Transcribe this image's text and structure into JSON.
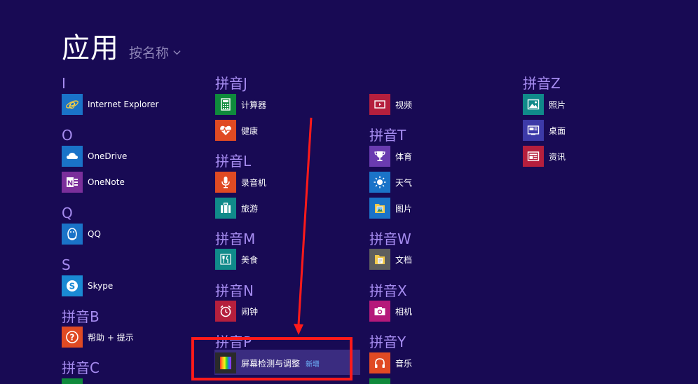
{
  "header": {
    "title": "应用",
    "sort_label": "按名称"
  },
  "groups": {
    "I": "I",
    "O": "O",
    "Q": "Q",
    "S": "S",
    "B": "拼音B",
    "C": "拼音C",
    "J": "拼音J",
    "L": "拼音L",
    "M": "拼音M",
    "N": "拼音N",
    "P": "拼音P",
    "T": "拼音T",
    "W": "拼音W",
    "X": "拼音X",
    "Y": "拼音Y",
    "Z": "拼音Z"
  },
  "apps": {
    "internet_explorer": "Internet Explorer",
    "onedrive": "OneDrive",
    "onenote": "OneNote",
    "qq": "QQ",
    "skype": "Skype",
    "help": "帮助 + 提示",
    "calculator": "计算器",
    "health": "健康",
    "recorder": "录音机",
    "travel": "旅游",
    "food": "美食",
    "alarm": "闹钟",
    "screen_calibration": "屏幕检测与调整",
    "screen_calibration_badge": "新增",
    "video": "视频",
    "sports": "体育",
    "weather": "天气",
    "pictures": "图片",
    "documents": "文档",
    "camera": "相机",
    "music": "音乐",
    "photos": "照片",
    "desktop": "桌面",
    "news": "资讯"
  },
  "colors": {
    "background": "#180a54",
    "group_header": "#a68cf0",
    "tile_blue": "#1a73c8",
    "tile_green": "#0f8a3c",
    "tile_orange": "#e04a23",
    "tile_teal": "#108a8a",
    "tile_red": "#b51f3d",
    "tile_purple": "#7b2f9b",
    "tile_indigo": "#3d3aa8",
    "annotation_red": "#ff1a1a"
  }
}
